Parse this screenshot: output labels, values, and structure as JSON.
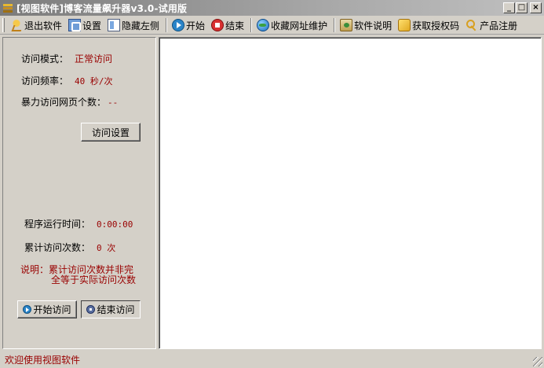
{
  "window": {
    "title": "[视图软件]博客流量飙升器v3.0-试用版",
    "controls": [
      "_",
      "□",
      "×"
    ]
  },
  "toolbar": {
    "items": [
      {
        "label": "退出软件",
        "icon": "exit-icon"
      },
      {
        "label": "设置",
        "icon": "settings-icon"
      },
      {
        "label": "隐藏左侧",
        "icon": "hide-panel-icon"
      },
      {
        "label": "开始",
        "icon": "start-icon"
      },
      {
        "label": "结束",
        "icon": "stop-icon"
      },
      {
        "label": "收藏网址维护",
        "icon": "globe-icon"
      },
      {
        "label": "软件说明",
        "icon": "help-icon"
      },
      {
        "label": "获取授权码",
        "icon": "authorization-icon"
      },
      {
        "label": "产品注册",
        "icon": "key-icon"
      }
    ]
  },
  "left": {
    "mode_label": "访问模式：",
    "mode_value": "正常访问",
    "freq_label": "访问频率：",
    "freq_value": "40 秒/次",
    "brute_label": "暴力访问网页个数：",
    "brute_value": "--",
    "settings_button": "访问设置",
    "runtime_label": "程序运行时间：",
    "runtime_value": "0:00:00",
    "count_label": "累计访问次数：",
    "count_value": "0 次",
    "note_line1": "说明：累计访问次数并非完",
    "note_line2": "全等于实际访问次数",
    "start_button": "开始访问",
    "stop_button": "结束访问"
  },
  "status": {
    "text": "欢迎使用视图软件"
  },
  "colors": {
    "accent_text": "#990000",
    "face": "#d4d0c8"
  }
}
